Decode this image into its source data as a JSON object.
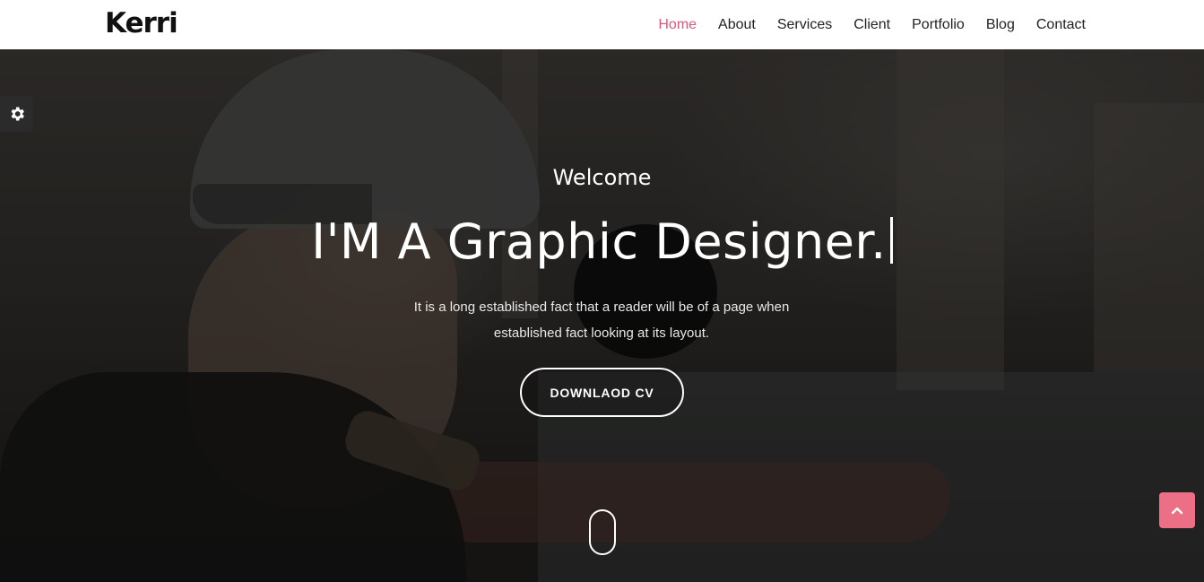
{
  "brand": {
    "logo": "Kerri"
  },
  "nav": {
    "items": [
      {
        "label": "Home",
        "active": true
      },
      {
        "label": "About",
        "active": false
      },
      {
        "label": "Services",
        "active": false
      },
      {
        "label": "Client",
        "active": false
      },
      {
        "label": "Portfolio",
        "active": false
      },
      {
        "label": "Blog",
        "active": false
      },
      {
        "label": "Contact",
        "active": false
      }
    ],
    "active_color": "#e0577a"
  },
  "hero": {
    "welcome": "Welcome",
    "headline": "I'M A Graphic Designer.",
    "description_line1": "It is a long established fact that a reader will be of a page when",
    "description_line2": "established fact looking at its layout.",
    "cv_button": "DOWNLAOD CV"
  },
  "widgets": {
    "settings_icon": "gear-icon",
    "scroll_icon": "mouse-scroll-icon",
    "back_to_top_icon": "chevron-up-icon",
    "back_to_top_color": "#ec6f85"
  }
}
